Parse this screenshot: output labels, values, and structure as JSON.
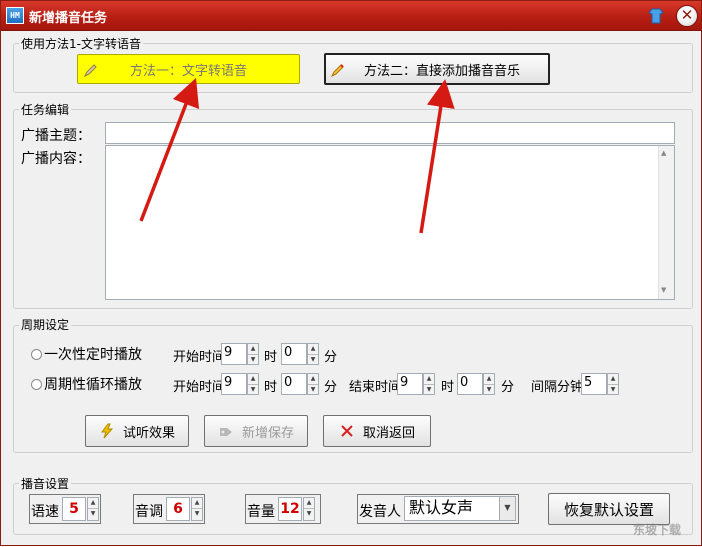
{
  "window": {
    "title": "新增播音任务",
    "app_icon_text": "HM"
  },
  "method_group": {
    "legend": "使用方法1-文字转语音",
    "btn_text_to_speech": "方法一：文字转语音",
    "btn_add_music": "方法二：直接添加播音音乐"
  },
  "task_edit": {
    "legend": "任务编辑",
    "topic_label": "广播主题：",
    "topic_value": "",
    "content_label": "广播内容：",
    "content_value": ""
  },
  "period": {
    "legend": "周期设定",
    "once": {
      "label": "一次性定时播放",
      "start_label": "开始时间",
      "hour": "9",
      "hour_unit": "时",
      "minute": "0",
      "minute_unit": "分"
    },
    "cycle": {
      "label": "周期性循环播放",
      "start_label": "开始时间",
      "start_hour": "9",
      "hour_unit": "时",
      "start_minute": "0",
      "minute_unit": "分",
      "end_label": "结束时间",
      "end_hour": "9",
      "end_minute": "0",
      "interval_label": "间隔分钟",
      "interval": "5"
    },
    "btn_preview": "试听效果",
    "btn_save": "新增保存",
    "btn_cancel": "取消返回"
  },
  "voice": {
    "legend": "播音设置",
    "speed_label": "语速",
    "speed": "5",
    "pitch_label": "音调",
    "pitch": "6",
    "volume_label": "音量",
    "volume": "12",
    "speaker_label": "发音人",
    "speaker": "默认女声",
    "btn_reset": "恢复默认设置"
  },
  "watermark": "东坡下载"
}
